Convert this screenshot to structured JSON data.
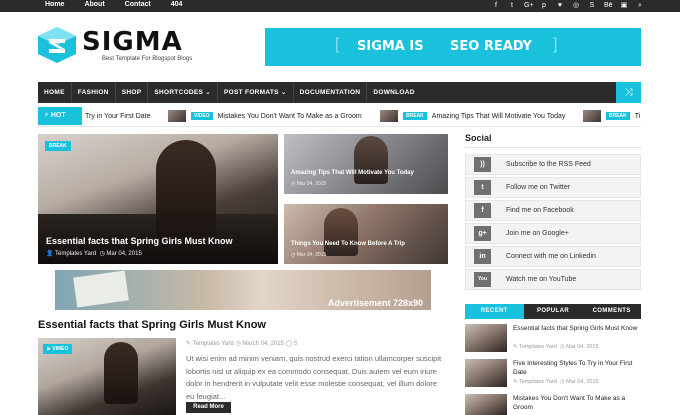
{
  "topbar": {
    "nav": [
      "Home",
      "About",
      "Contact",
      "404"
    ],
    "social_icons": [
      {
        "name": "facebook-icon",
        "glyph": "f"
      },
      {
        "name": "twitter-icon",
        "glyph": "t"
      },
      {
        "name": "google-plus-icon",
        "glyph": "G+"
      },
      {
        "name": "pinterest-icon",
        "glyph": "p"
      },
      {
        "name": "heart-icon",
        "glyph": "♥"
      },
      {
        "name": "instagram-icon",
        "glyph": "◎"
      },
      {
        "name": "skype-icon",
        "glyph": "S"
      },
      {
        "name": "behance-icon",
        "glyph": "Bē"
      },
      {
        "name": "foursquare-icon",
        "glyph": "▣"
      },
      {
        "name": "search-icon",
        "glyph": "⌕"
      }
    ]
  },
  "logo": {
    "title": "SIGMA",
    "tagline": "Best Template For Blogspot Blogs"
  },
  "banner": {
    "part1": "SIGMA IS",
    "part2": "SEO READY"
  },
  "main_nav": {
    "items": [
      "HOME",
      "FASHION",
      "SHOP",
      "SHORTCODES ⌄",
      "POST FORMATS ⌄",
      "DOCUMENTATION",
      "DOWNLOAD"
    ],
    "shuffle_icon": "⤨"
  },
  "ticker": {
    "label": "HOT",
    "items": [
      {
        "tag": "",
        "text": "Try in Your First Date"
      },
      {
        "tag": "VIDEO",
        "text": "Mistakes You Don't Want To Make as a Groom"
      },
      {
        "tag": "BREAK",
        "text": "Amazing Tips That Will Motivate You Today"
      },
      {
        "tag": "BREAK",
        "text": "Ti"
      }
    ]
  },
  "featured": {
    "big": {
      "tag": "BREAK",
      "title": "Essential facts that Spring Girls Must Know",
      "author": "Templates Yard",
      "date": "Mar 04, 2015"
    },
    "small": [
      {
        "title": "Amazing Tips That Will Motivate You Today",
        "date": "Mar 04, 2015"
      },
      {
        "title": "Things You Need To Know Before A Trip",
        "date": "Mar 04, 2015"
      }
    ]
  },
  "ad": {
    "label": "Advertisement 728x90"
  },
  "post": {
    "title": "Essential facts that Spring Girls Must Know",
    "tag": "VIMEO",
    "meta": "✎ Templates Yard   ◷ March 04, 2015   ◯ 5",
    "excerpt": "Ut wisi enim ad minim veniam, quis nostrud exerci tation ullamcorper suscipit lobortis nisl ut aliquip ex ea commodo consequat. Duis autem vel eum iriure dolor in hendrerit in vulputate velit esse molestie consequat, vel illum dolore eu feugiat...",
    "read_more": "Read More"
  },
  "sidebar": {
    "social_heading": "Social",
    "social": [
      {
        "icon": "rss-icon",
        "glyph": "))",
        "label": "Subscribe to the RSS Feed"
      },
      {
        "icon": "twitter-icon",
        "glyph": "t",
        "label": "Follow me on Twitter"
      },
      {
        "icon": "facebook-icon",
        "glyph": "f",
        "label": "Find me on Facebook"
      },
      {
        "icon": "google-plus-icon",
        "glyph": "g+",
        "label": "Join me on Google+"
      },
      {
        "icon": "linkedin-icon",
        "glyph": "in",
        "label": "Connect with me on Linkedin"
      },
      {
        "icon": "youtube-icon",
        "glyph": "You",
        "label": "Watch me on YouTube"
      }
    ],
    "tabs": [
      "RECENT",
      "POPULAR",
      "COMMENTS"
    ],
    "recent": [
      {
        "title": "Essential facts that Spring Girls Must Know",
        "author": "Templates Yard",
        "date": "Mar 04, 2015"
      },
      {
        "title": "Five Interesting Styles To Try in Your First Date",
        "author": "Templates Yard",
        "date": "Mar 04, 2015"
      },
      {
        "title": "Mistakes You Don't Want To Make as a Groom",
        "author": "",
        "date": ""
      }
    ]
  },
  "colors": {
    "accent": "#19c1dd",
    "dark": "#2b2b2b"
  }
}
